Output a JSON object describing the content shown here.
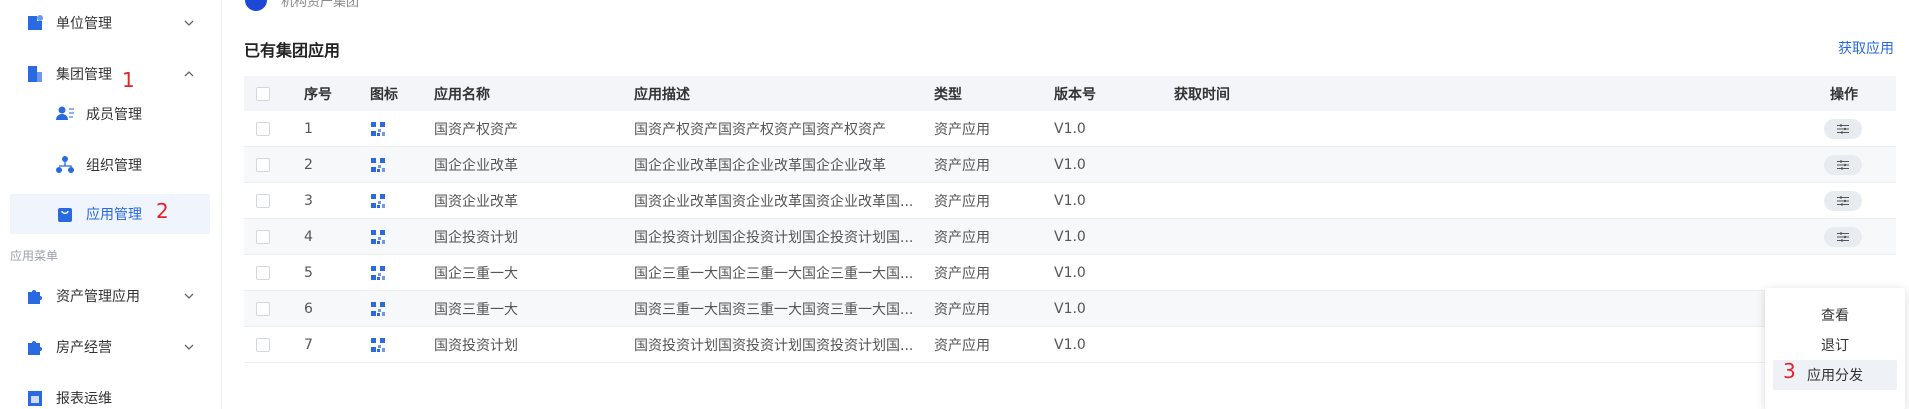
{
  "sidebar": {
    "items": [
      {
        "label": "单位管理",
        "icon": "unit-icon"
      },
      {
        "label": "集团管理",
        "icon": "group-icon"
      },
      {
        "label": "成员管理",
        "icon": "member-icon"
      },
      {
        "label": "组织管理",
        "icon": "org-icon"
      },
      {
        "label": "应用管理",
        "icon": "app-icon"
      },
      {
        "label": "资产管理应用",
        "icon": "puzzle-icon"
      },
      {
        "label": "房产经营",
        "icon": "puzzle-icon"
      },
      {
        "label": "报表运维",
        "icon": "report-icon"
      }
    ],
    "section_label": "应用菜单"
  },
  "annotations": {
    "a1": "1",
    "a2": "2",
    "a3": "3"
  },
  "breadcrumb": {
    "text": "机构资产集团"
  },
  "main": {
    "title": "已有集团应用",
    "get_app_link": "获取应用"
  },
  "table": {
    "columns": [
      "序号",
      "图标",
      "应用名称",
      "应用描述",
      "类型",
      "版本号",
      "获取时间",
      "操作"
    ],
    "rows": [
      {
        "no": "1",
        "name": "国资产权资产",
        "desc": "国资产权资产国资产权资产国资产权资产",
        "type": "资产应用",
        "version": "V1.0",
        "time": ""
      },
      {
        "no": "2",
        "name": "国企企业改革",
        "desc": "国企企业改革国企企业改革国企企业改革",
        "type": "资产应用",
        "version": "V1.0",
        "time": ""
      },
      {
        "no": "3",
        "name": "国资企业改革",
        "desc": "国资企业改革国资企业改革国资企业改革国...",
        "type": "资产应用",
        "version": "V1.0",
        "time": ""
      },
      {
        "no": "4",
        "name": "国企投资计划",
        "desc": "国企投资计划国企投资计划国企投资计划国...",
        "type": "资产应用",
        "version": "V1.0",
        "time": ""
      },
      {
        "no": "5",
        "name": "国企三重一大",
        "desc": "国企三重一大国企三重一大国企三重一大国...",
        "type": "资产应用",
        "version": "V1.0",
        "time": ""
      },
      {
        "no": "6",
        "name": "国资三重一大",
        "desc": "国资三重一大国资三重一大国资三重一大国...",
        "type": "资产应用",
        "version": "V1.0",
        "time": ""
      },
      {
        "no": "7",
        "name": "国资投资计划",
        "desc": "国资投资计划国资投资计划国资投资计划国...",
        "type": "资产应用",
        "version": "V1.0",
        "time": ""
      }
    ]
  },
  "popup_menu": {
    "view": "查看",
    "unsubscribe": "退订",
    "distribute": "应用分发"
  },
  "colors": {
    "accent": "#2a6ae0",
    "annotation": "#e0252b",
    "header_bg": "#f3f5f9"
  }
}
